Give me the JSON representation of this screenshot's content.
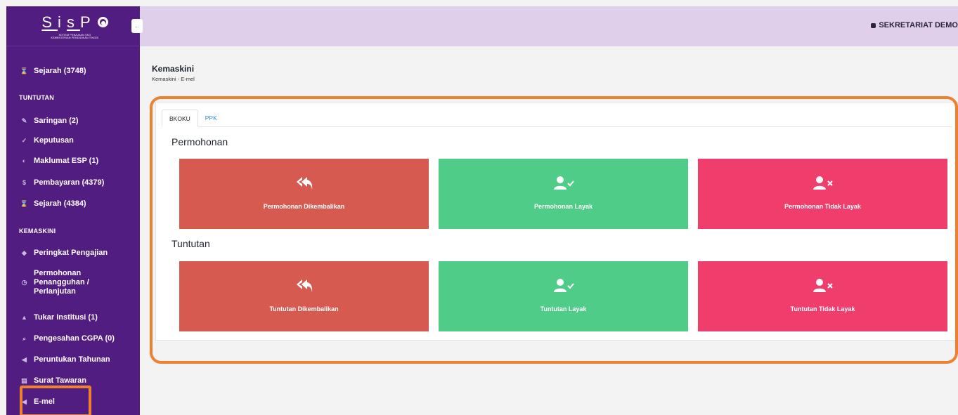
{
  "app": {
    "logo_text": "SisPO",
    "logo_letters": [
      "S",
      "i",
      "s",
      "P"
    ],
    "logo_subtitle_1": "SISTEM PENAJAAN SKO",
    "logo_subtitle_2": "KEMENTERIAN PENDIDIKAN TINGGI"
  },
  "topbar": {
    "user": "SEKRETARIAT DEMO",
    "collapse_icon": "arrow-left-icon"
  },
  "sidebar": {
    "items_top": [
      {
        "label": "Sejarah (3748)",
        "icon": "hourglass-icon"
      }
    ],
    "section_tuntutan": "TUNTUTAN",
    "items_tuntutan": [
      {
        "label": "Saringan (2)",
        "icon": "filter-icon"
      },
      {
        "label": "Keputusan",
        "icon": "check-icon"
      },
      {
        "label": "Maklumat ESP (1)",
        "icon": "info-icon"
      },
      {
        "label": "Pembayaran (4379)",
        "icon": "dollar-icon"
      },
      {
        "label": "Sejarah (4384)",
        "icon": "hourglass-icon"
      }
    ],
    "section_kemaskini": "KEMASKINI",
    "items_kemaskini": [
      {
        "label": "Peringkat Pengajian",
        "icon": "graduation-cap-icon"
      },
      {
        "label_lines": [
          "Permohonan",
          "Penangguhan /",
          "Perlanjutan"
        ],
        "icon": "clock-icon"
      },
      {
        "label": "Tukar Institusi (1)",
        "icon": "user-icon"
      },
      {
        "label": "Pengesahan CGPA (0)",
        "icon": "search-icon"
      },
      {
        "label": "Peruntukan Tahunan",
        "icon": "send-icon"
      },
      {
        "label": "Surat Tawaran",
        "icon": "document-icon"
      },
      {
        "label": "E-mel",
        "icon": "send-icon"
      }
    ]
  },
  "page": {
    "title": "Kemaskini",
    "breadcrumb": "Kemaskini  -  E-mel"
  },
  "tabs": [
    {
      "label": "BKOKU",
      "active": true
    },
    {
      "label": "PPK",
      "active": false
    }
  ],
  "sections": [
    {
      "title": "Permohonan",
      "tiles": [
        {
          "label": "Permohonan Dikembalikan",
          "color": "#d65a50",
          "icon": "reply-all-icon"
        },
        {
          "label": "Permohonan Layak",
          "color": "#4fcd88",
          "icon": "user-check-icon"
        },
        {
          "label": "Permohonan Tidak Layak",
          "color": "#ef3d6c",
          "icon": "user-times-icon"
        }
      ]
    },
    {
      "title": "Tuntutan",
      "tiles": [
        {
          "label": "Tuntutan Dikembalikan",
          "color": "#d65a50",
          "icon": "reply-all-icon"
        },
        {
          "label": "Tuntutan Layak",
          "color": "#4fcd88",
          "icon": "user-check-icon"
        },
        {
          "label": "Tuntutan Tidak Layak",
          "color": "#ef3d6c",
          "icon": "user-times-icon"
        }
      ]
    }
  ],
  "colors": {
    "sidebar_bg": "#521d80",
    "topbar_bg": "#dfcfeb",
    "highlight": "#ee8130"
  }
}
